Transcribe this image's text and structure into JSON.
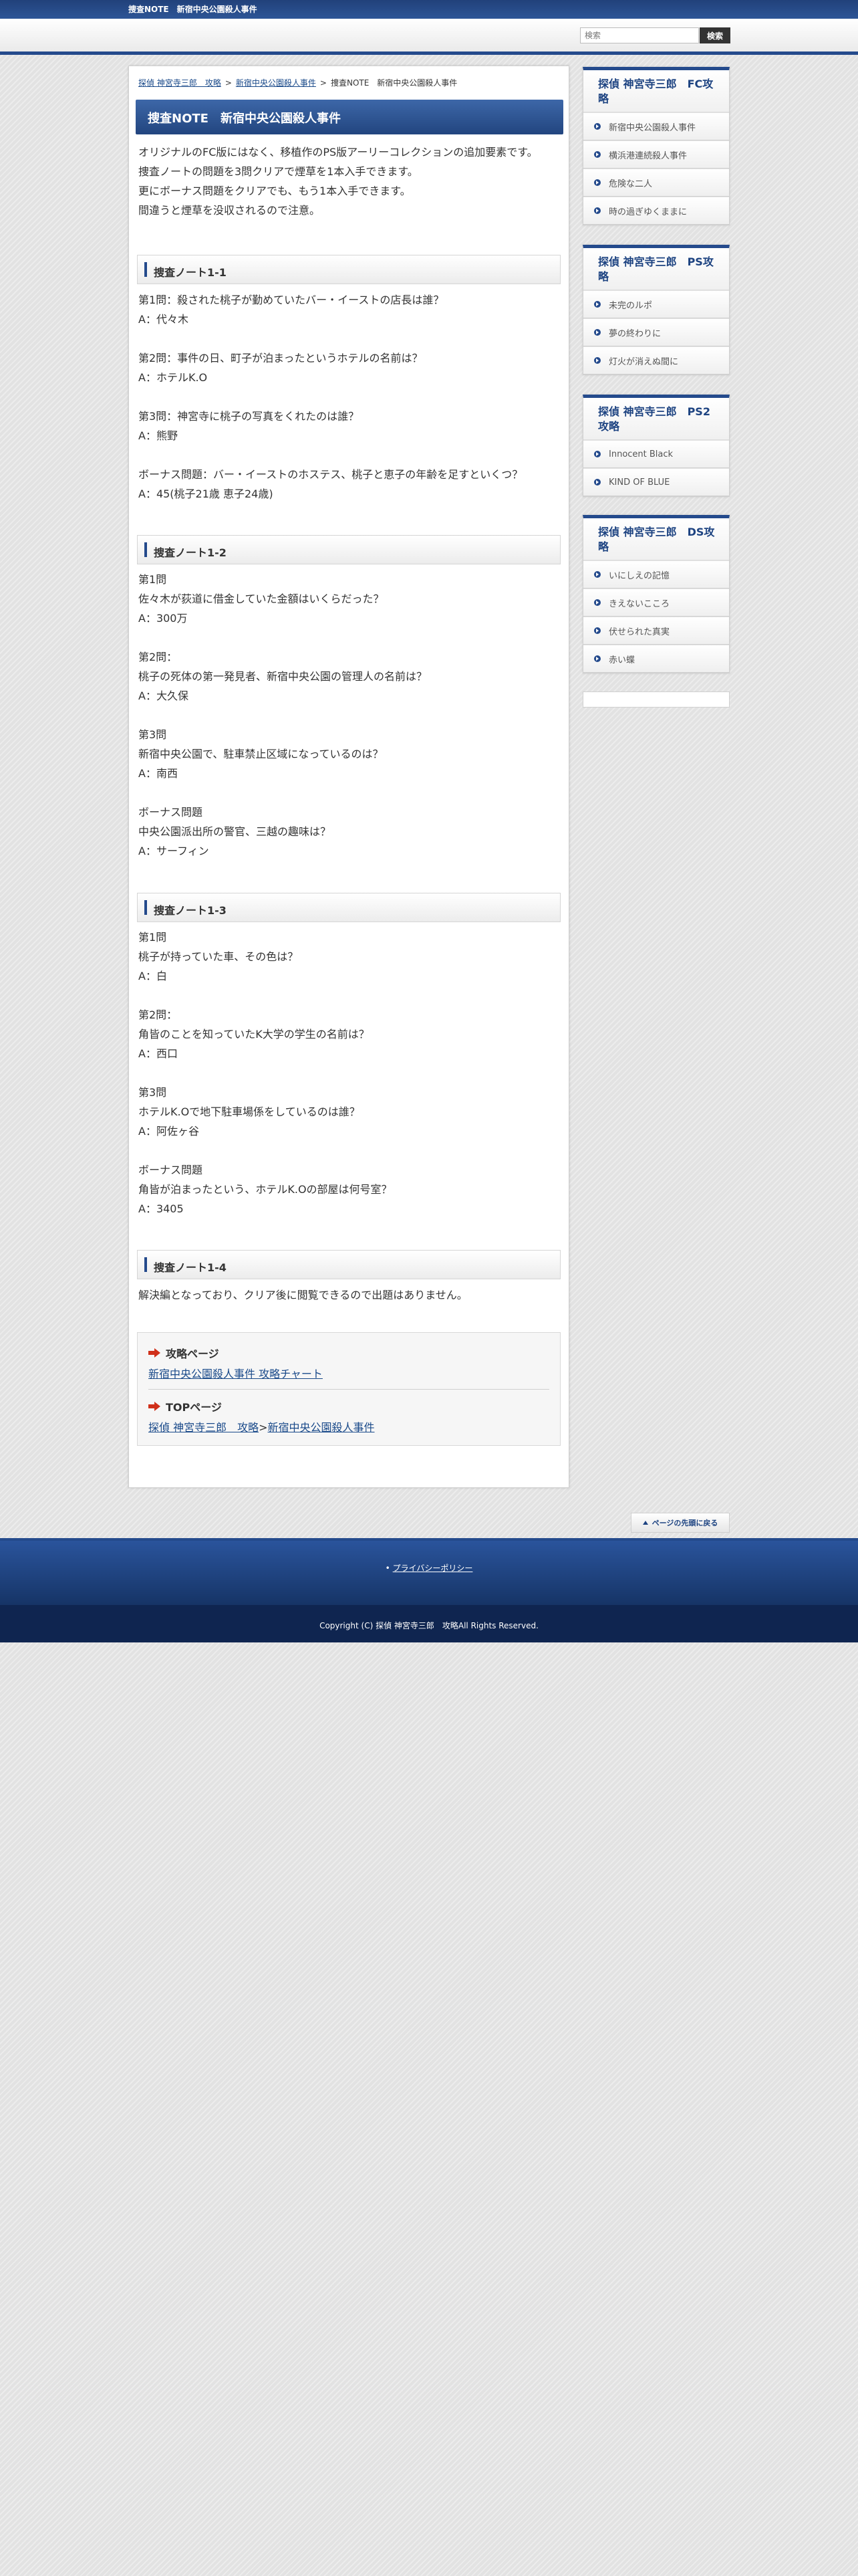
{
  "topbar": {
    "title": "捜査NOTE　新宿中央公園殺人事件"
  },
  "search": {
    "placeholder": "検索",
    "button_label": "検索"
  },
  "breadcrumb": {
    "home": "探偵 神宮寺三郎　攻略",
    "parent": "新宿中央公園殺人事件",
    "current": "捜査NOTE　新宿中央公園殺人事件",
    "separator": ">"
  },
  "page": {
    "title": "捜査NOTE　新宿中央公園殺人事件",
    "intro": [
      "オリジナルのFC版にはなく、移植作のPS版アーリーコレクションの追加要素です。",
      "捜査ノートの問題を3問クリアで煙草を1本入手できます。",
      "更にボーナス問題をクリアでも、もう1本入手できます。",
      "間違うと煙草を没収されるので注意。"
    ]
  },
  "sections": [
    {
      "heading": "捜査ノート1-1",
      "blocks": [
        [
          "第1問：殺された桃子が勤めていたバー・イーストの店長は誰？",
          "A：代々木"
        ],
        [
          "第2問：事件の日、町子が泊まったというホテルの名前は？",
          "A：ホテルK.O"
        ],
        [
          "第3問：神宮寺に桃子の写真をくれたのは誰？",
          "A：熊野"
        ],
        [
          "ボーナス問題：バー・イーストのホステス、桃子と恵子の年齢を足すといくつ？",
          "A：45(桃子21歳 恵子24歳)"
        ]
      ]
    },
    {
      "heading": "捜査ノート1-2",
      "blocks": [
        [
          "第1問",
          "佐々木が荻道に借金していた金額はいくらだった？",
          "A：300万"
        ],
        [
          "第2問：",
          "桃子の死体の第一発見者、新宿中央公園の管理人の名前は？",
          "A：大久保"
        ],
        [
          "第3問",
          "新宿中央公園で、駐車禁止区域になっているのは？",
          "A：南西"
        ],
        [
          "ボーナス問題",
          "中央公園派出所の警官、三越の趣味は？",
          "A：サーフィン"
        ]
      ]
    },
    {
      "heading": "捜査ノート1-3",
      "blocks": [
        [
          "第1問",
          "桃子が持っていた車、その色は？",
          "A：白"
        ],
        [
          "第2問：",
          "角皆のことを知っていたK大学の学生の名前は？",
          "A：西口"
        ],
        [
          "第3問",
          "ホテルK.Oで地下駐車場係をしているのは誰？",
          "A：阿佐ヶ谷"
        ],
        [
          "ボーナス問題",
          "角皆が泊まったという、ホテルK.Oの部屋は何号室？",
          "A：3405"
        ]
      ]
    },
    {
      "heading": "捜査ノート1-4",
      "blocks": [
        [
          "解決編となっており、クリア後に閲覧できるので出題はありません。"
        ]
      ]
    }
  ],
  "links": {
    "guide_heading": "攻略ページ",
    "guide_link": "新宿中央公園殺人事件 攻略チャート",
    "top_heading": "TOPページ",
    "top_link_home": "探偵 神宮寺三郎　攻略",
    "top_link_sep": ">",
    "top_link_case": "新宿中央公園殺人事件"
  },
  "sidebar": [
    {
      "title": "探偵 神宮寺三郎　FC攻略",
      "items": [
        "新宿中央公園殺人事件",
        "横浜港連続殺人事件",
        "危険な二人",
        "時の過ぎゆくままに"
      ]
    },
    {
      "title": "探偵 神宮寺三郎　PS攻略",
      "items": [
        "未完のルポ",
        "夢の終わりに",
        "灯火が消えぬ間に"
      ]
    },
    {
      "title": "探偵 神宮寺三郎　PS2攻略",
      "items": [
        "Innocent Black",
        "KIND OF BLUE"
      ]
    },
    {
      "title": "探偵 神宮寺三郎　DS攻略",
      "items": [
        "いにしえの記憶",
        "きえないこころ",
        "伏せられた真実",
        "赤い蝶"
      ]
    }
  ],
  "to_top": {
    "label": "ページの先頭に戻る"
  },
  "footer": {
    "privacy": "プライバシーポリシー",
    "copyright": "Copyright (C) 探偵 神宮寺三郎　攻略All Rights Reserved."
  },
  "colors": {
    "brand": "#244a8c",
    "accent_arrow": "#d0301a",
    "link": "#1a4a8a"
  }
}
